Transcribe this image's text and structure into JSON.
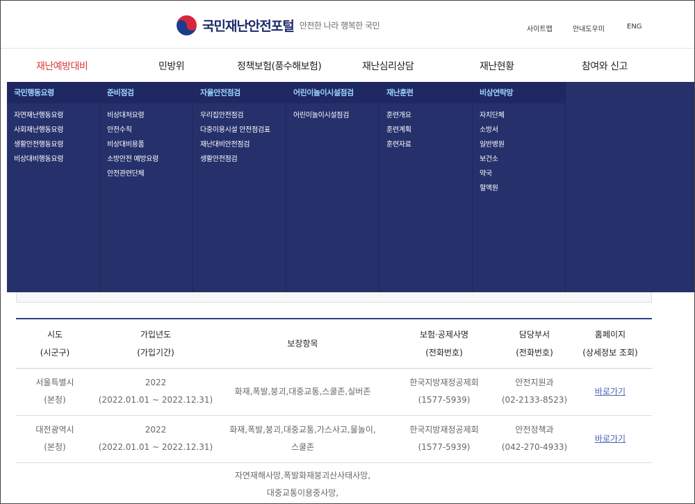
{
  "header": {
    "title": "국민재난안전포털",
    "slogan": "안전한 나라 행복한 국민",
    "utils": [
      "사이트맵",
      "안내도우미",
      "ENG"
    ]
  },
  "gnb": [
    "재난예방대비",
    "민방위",
    "정책보험(풍수해보험)",
    "재난심리상담",
    "재난현황",
    "참여와 신고"
  ],
  "dropdown": [
    {
      "title": "국민행동요령",
      "items": [
        "자연재난행동요령",
        "사회재난행동요령",
        "생활안전행동요령",
        "비상대비행동요령"
      ]
    },
    {
      "title": "준비점검",
      "items": [
        "비상대처요령",
        "안전수칙",
        "비상대비용품",
        "소방안전 예방요령",
        "안전관련단체"
      ]
    },
    {
      "title": "자율안전점검",
      "items": [
        "우리집안전점검",
        "다중이용시설 안전점검표",
        "재난대비안전점검",
        "생활안전점검"
      ]
    },
    {
      "title": "어린이놀이시설점검",
      "items": [
        "어린이놀이시설점검"
      ]
    },
    {
      "title": "재난훈련",
      "items": [
        "훈련개요",
        "훈련계획",
        "훈련자료"
      ]
    },
    {
      "title": "비상연락망",
      "items": [
        "자치단체",
        "소방서",
        "일반병원",
        "보건소",
        "약국",
        "혈액원"
      ]
    }
  ],
  "table": {
    "headers": [
      [
        "시도",
        "(시군구)"
      ],
      [
        "가입년도",
        "(가입기간)"
      ],
      [
        "보장항목"
      ],
      [
        "보험·공제사명",
        "(전화번호)"
      ],
      [
        "담당부서",
        "(전화번호)"
      ],
      [
        "홈페이지",
        "(상세정보 조회)"
      ]
    ],
    "rows": [
      {
        "region": [
          "서울특별시",
          "(본청)"
        ],
        "year": [
          "2022",
          "(2022.01.01 ~ 2022.12.31)"
        ],
        "coverage": [
          "화재,폭발,붕괴,대중교통,스쿨존,실버존"
        ],
        "insurer": [
          "한국지방재정공제회",
          "(1577-5939)"
        ],
        "dept": [
          "안전지원과",
          "(02-2133-8523)"
        ],
        "link": "바로가기"
      },
      {
        "region": [
          "대전광역시",
          "(본청)"
        ],
        "year": [
          "2022",
          "(2022.01.01 ~ 2022.12.31)"
        ],
        "coverage": [
          "화재,폭발,붕괴,대중교통,가스사고,물놀이,",
          "스쿨존"
        ],
        "insurer": [
          "한국지방재정공제회",
          "(1577-5939)"
        ],
        "dept": [
          "안전정책과",
          "(042-270-4933)"
        ],
        "link": "바로가기"
      }
    ],
    "partial_row": {
      "coverage": [
        "자연재해사망,폭발화재붕괴산사태사망,",
        "대중교통이용중사망,"
      ]
    }
  },
  "colors": {
    "dropdown_bg": "#26306b",
    "dropdown_head": "#9ed3ff",
    "active_menu": "#d93a3a",
    "table_top_border": "#2e3d8a"
  }
}
